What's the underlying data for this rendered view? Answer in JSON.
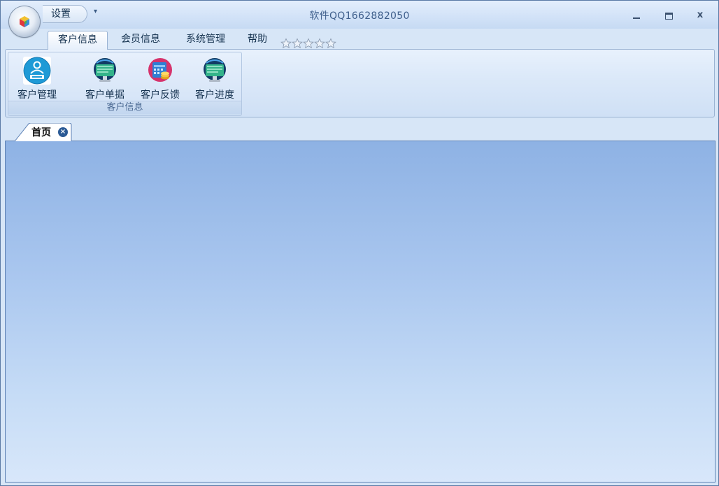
{
  "window": {
    "title": "软件QQ1662882050",
    "close_glyph": "x"
  },
  "quick_access": {
    "settings_label": "设置",
    "dropdown_glyph": "▾"
  },
  "ribbon": {
    "tabs": [
      {
        "label": "客户信息",
        "active": true
      },
      {
        "label": "会员信息",
        "active": false
      },
      {
        "label": "系统管理",
        "active": false
      },
      {
        "label": "帮助",
        "active": false
      }
    ],
    "rating_stars": 5,
    "groups": [
      {
        "label": "客户信息",
        "buttons": [
          {
            "label": "客户管理",
            "icon": "client-icon"
          },
          {
            "label": "客户单据",
            "icon": "monitor-globe-icon"
          },
          {
            "label": "客户反馈",
            "icon": "calendar-coins-icon"
          },
          {
            "label": "客户进度",
            "icon": "monitor-globe-icon"
          }
        ]
      }
    ]
  },
  "document_tabs": [
    {
      "label": "首页",
      "close_glyph": "×"
    }
  ],
  "colors": {
    "title_text": "#3f5f8c",
    "content_top": "#8eb2e4",
    "content_bottom": "#d8e7fa",
    "border": "#5d81b4"
  }
}
